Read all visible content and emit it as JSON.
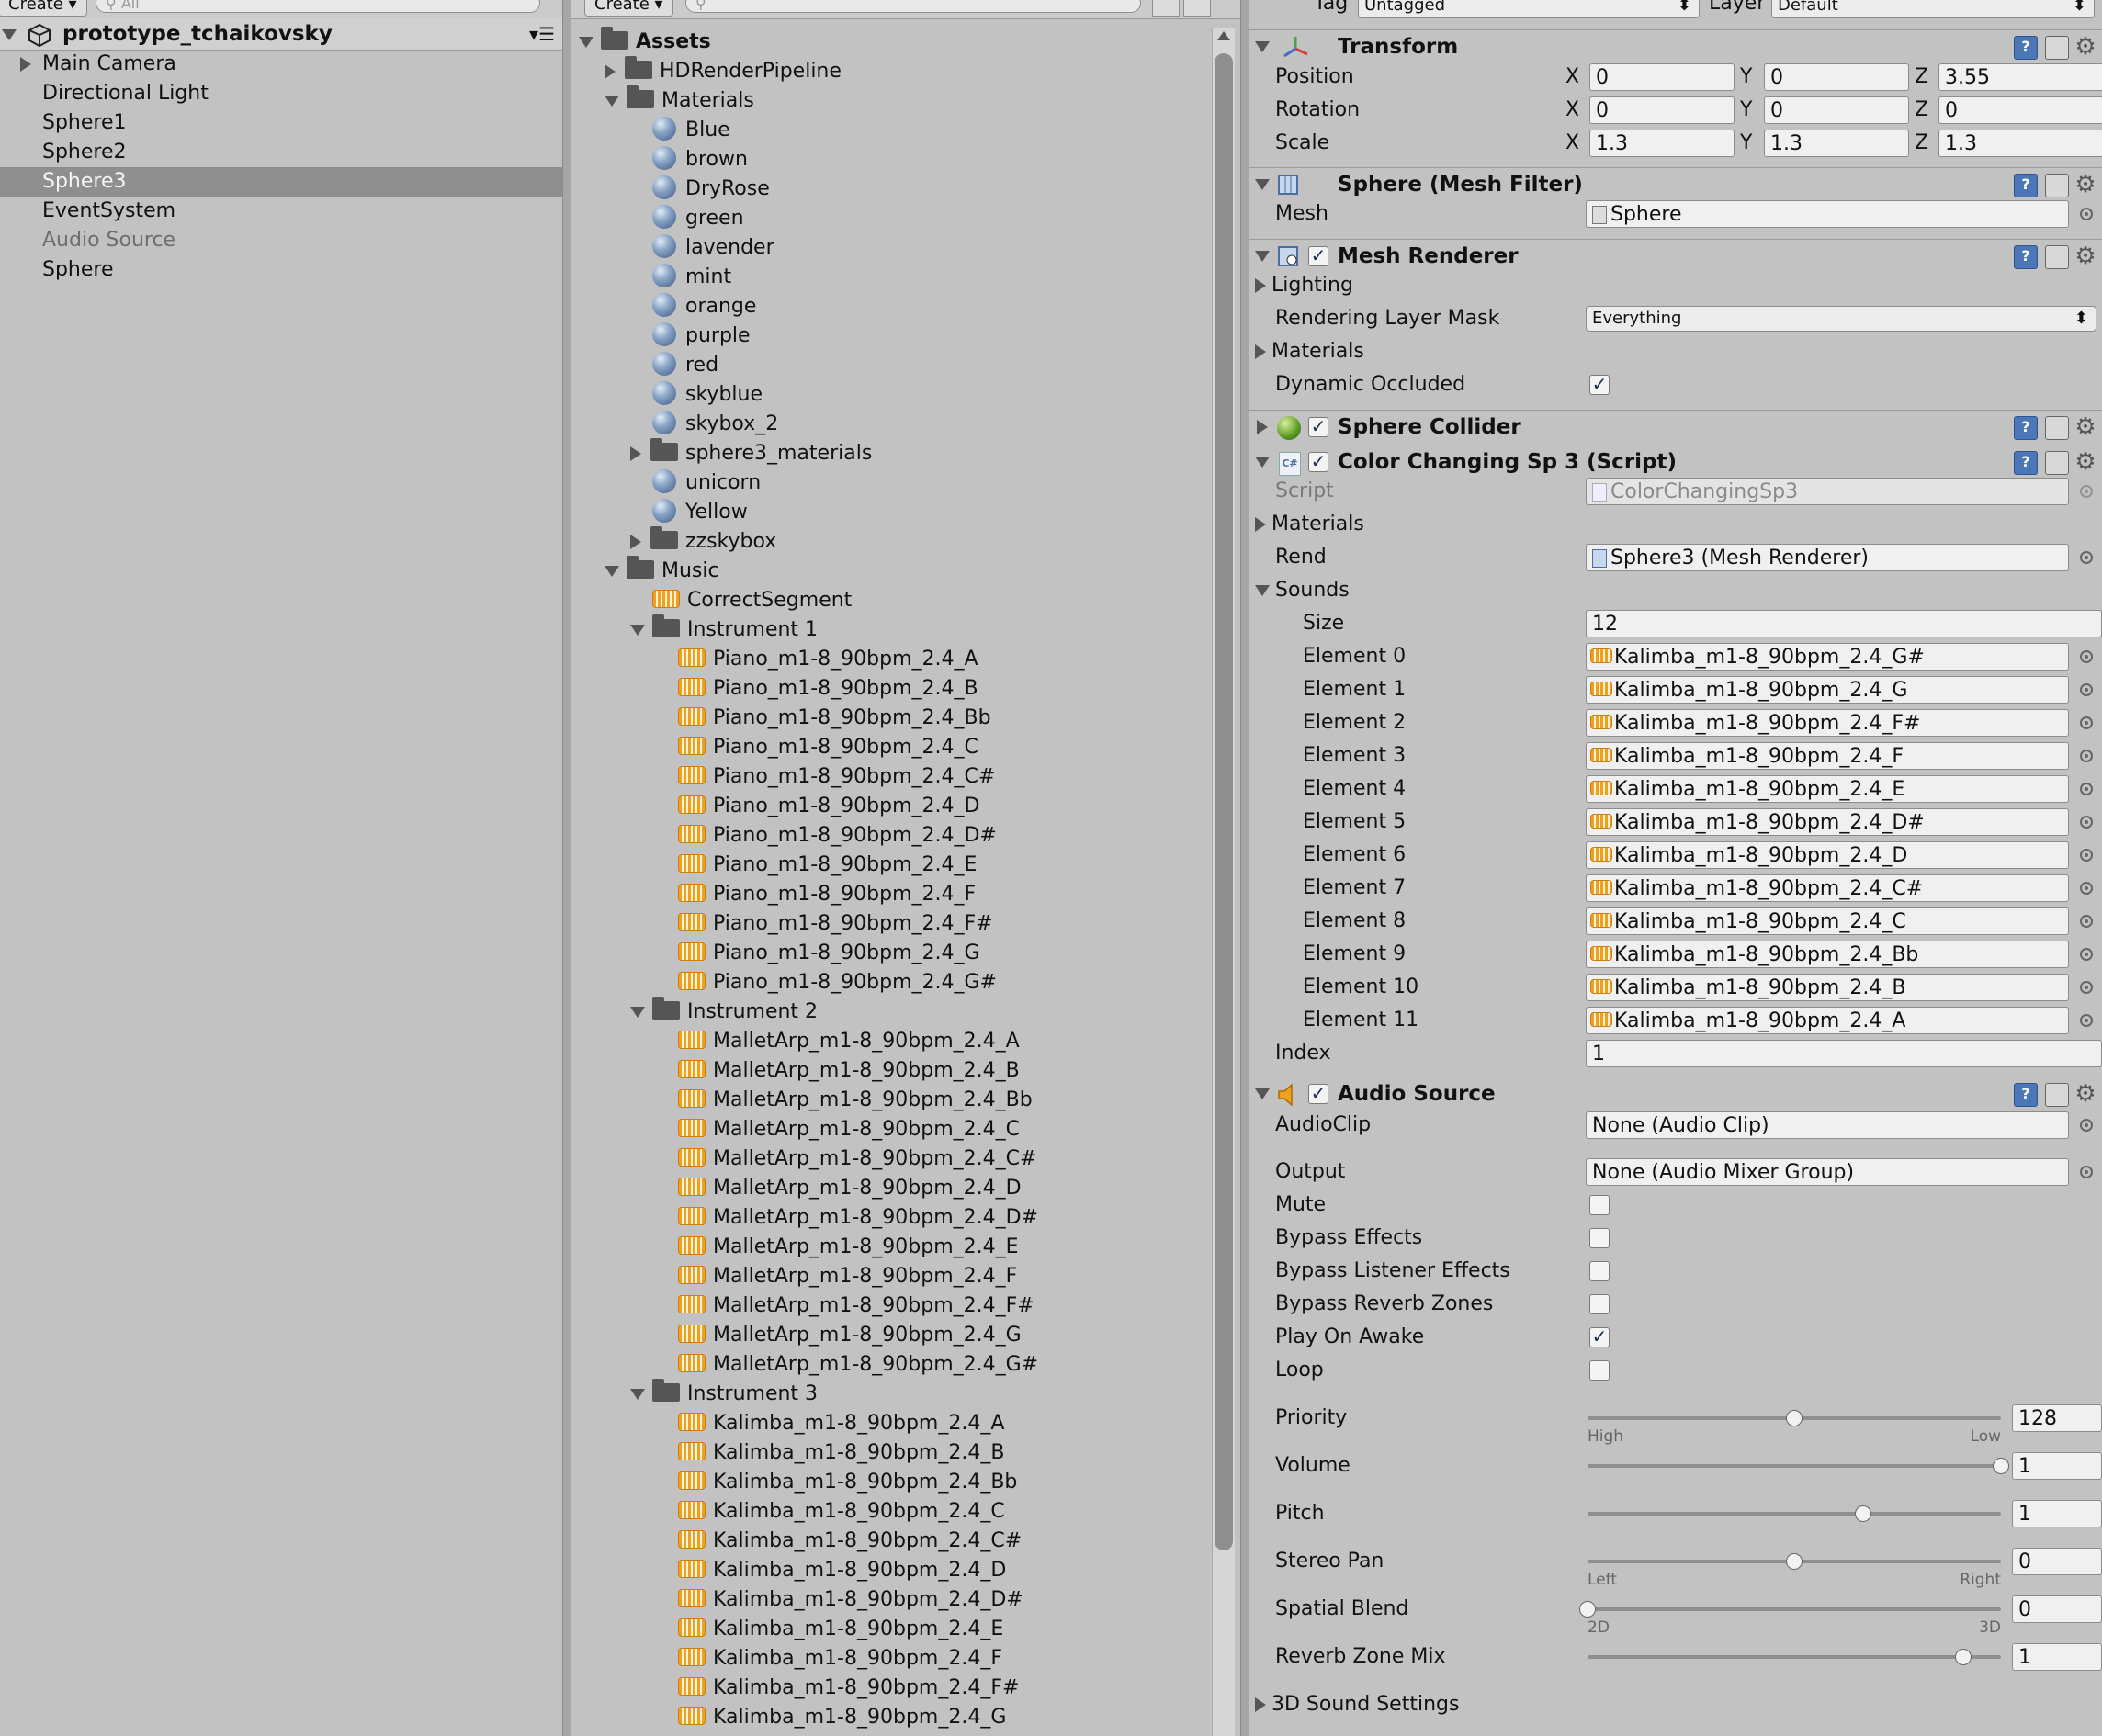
{
  "hierarchy": {
    "create_label": "Create",
    "search_placeholder": "All",
    "scene_name": "prototype_tchaikovsky",
    "items": [
      {
        "label": "Main Camera",
        "expandable": true
      },
      {
        "label": "Directional Light"
      },
      {
        "label": "Sphere1"
      },
      {
        "label": "Sphere2"
      },
      {
        "label": "Sphere3",
        "selected": true
      },
      {
        "label": "EventSystem"
      },
      {
        "label": "Audio Source",
        "inactive": true
      },
      {
        "label": "Sphere"
      }
    ]
  },
  "project": {
    "create_label": "Create",
    "root": "Assets",
    "rows": [
      {
        "label": "HDRenderPipeline",
        "kind": "folder",
        "depth": 1,
        "arrow": "collapsed"
      },
      {
        "label": "Materials",
        "kind": "folder",
        "depth": 1,
        "arrow": "expanded"
      },
      {
        "label": "Blue",
        "kind": "material",
        "depth": 2
      },
      {
        "label": "brown",
        "kind": "material",
        "depth": 2
      },
      {
        "label": "DryRose",
        "kind": "material",
        "depth": 2
      },
      {
        "label": "green",
        "kind": "material",
        "depth": 2
      },
      {
        "label": "lavender",
        "kind": "material",
        "depth": 2
      },
      {
        "label": "mint",
        "kind": "material",
        "depth": 2
      },
      {
        "label": "orange",
        "kind": "material",
        "depth": 2
      },
      {
        "label": "purple",
        "kind": "material",
        "depth": 2
      },
      {
        "label": "red",
        "kind": "material",
        "depth": 2
      },
      {
        "label": "skyblue",
        "kind": "material",
        "depth": 2
      },
      {
        "label": "skybox_2",
        "kind": "material",
        "depth": 2
      },
      {
        "label": "sphere3_materials",
        "kind": "folder",
        "depth": 2,
        "arrow": "collapsed"
      },
      {
        "label": "unicorn",
        "kind": "material",
        "depth": 2
      },
      {
        "label": "Yellow",
        "kind": "material",
        "depth": 2
      },
      {
        "label": "zzskybox",
        "kind": "folder",
        "depth": 2,
        "arrow": "collapsed"
      },
      {
        "label": "Music",
        "kind": "folder",
        "depth": 1,
        "arrow": "expanded"
      },
      {
        "label": "CorrectSegment",
        "kind": "audio",
        "depth": 2
      },
      {
        "label": "Instrument 1",
        "kind": "folder",
        "depth": 2,
        "arrow": "expanded"
      },
      {
        "label": "Piano_m1-8_90bpm_2.4_A",
        "kind": "audio",
        "depth": 3
      },
      {
        "label": "Piano_m1-8_90bpm_2.4_B",
        "kind": "audio",
        "depth": 3
      },
      {
        "label": "Piano_m1-8_90bpm_2.4_Bb",
        "kind": "audio",
        "depth": 3
      },
      {
        "label": "Piano_m1-8_90bpm_2.4_C",
        "kind": "audio",
        "depth": 3
      },
      {
        "label": "Piano_m1-8_90bpm_2.4_C#",
        "kind": "audio",
        "depth": 3
      },
      {
        "label": "Piano_m1-8_90bpm_2.4_D",
        "kind": "audio",
        "depth": 3
      },
      {
        "label": "Piano_m1-8_90bpm_2.4_D#",
        "kind": "audio",
        "depth": 3
      },
      {
        "label": "Piano_m1-8_90bpm_2.4_E",
        "kind": "audio",
        "depth": 3
      },
      {
        "label": "Piano_m1-8_90bpm_2.4_F",
        "kind": "audio",
        "depth": 3
      },
      {
        "label": "Piano_m1-8_90bpm_2.4_F#",
        "kind": "audio",
        "depth": 3
      },
      {
        "label": "Piano_m1-8_90bpm_2.4_G",
        "kind": "audio",
        "depth": 3
      },
      {
        "label": "Piano_m1-8_90bpm_2.4_G#",
        "kind": "audio",
        "depth": 3
      },
      {
        "label": "Instrument 2",
        "kind": "folder",
        "depth": 2,
        "arrow": "expanded"
      },
      {
        "label": "MalletArp_m1-8_90bpm_2.4_A",
        "kind": "audio",
        "depth": 3
      },
      {
        "label": "MalletArp_m1-8_90bpm_2.4_B",
        "kind": "audio",
        "depth": 3
      },
      {
        "label": "MalletArp_m1-8_90bpm_2.4_Bb",
        "kind": "audio",
        "depth": 3
      },
      {
        "label": "MalletArp_m1-8_90bpm_2.4_C",
        "kind": "audio",
        "depth": 3
      },
      {
        "label": "MalletArp_m1-8_90bpm_2.4_C#",
        "kind": "audio",
        "depth": 3
      },
      {
        "label": "MalletArp_m1-8_90bpm_2.4_D",
        "kind": "audio",
        "depth": 3
      },
      {
        "label": "MalletArp_m1-8_90bpm_2.4_D#",
        "kind": "audio",
        "depth": 3
      },
      {
        "label": "MalletArp_m1-8_90bpm_2.4_E",
        "kind": "audio",
        "depth": 3
      },
      {
        "label": "MalletArp_m1-8_90bpm_2.4_F",
        "kind": "audio",
        "depth": 3
      },
      {
        "label": "MalletArp_m1-8_90bpm_2.4_F#",
        "kind": "audio",
        "depth": 3
      },
      {
        "label": "MalletArp_m1-8_90bpm_2.4_G",
        "kind": "audio",
        "depth": 3
      },
      {
        "label": "MalletArp_m1-8_90bpm_2.4_G#",
        "kind": "audio",
        "depth": 3
      },
      {
        "label": "Instrument 3",
        "kind": "folder",
        "depth": 2,
        "arrow": "expanded"
      },
      {
        "label": "Kalimba_m1-8_90bpm_2.4_A",
        "kind": "audio",
        "depth": 3
      },
      {
        "label": "Kalimba_m1-8_90bpm_2.4_B",
        "kind": "audio",
        "depth": 3
      },
      {
        "label": "Kalimba_m1-8_90bpm_2.4_Bb",
        "kind": "audio",
        "depth": 3
      },
      {
        "label": "Kalimba_m1-8_90bpm_2.4_C",
        "kind": "audio",
        "depth": 3
      },
      {
        "label": "Kalimba_m1-8_90bpm_2.4_C#",
        "kind": "audio",
        "depth": 3
      },
      {
        "label": "Kalimba_m1-8_90bpm_2.4_D",
        "kind": "audio",
        "depth": 3
      },
      {
        "label": "Kalimba_m1-8_90bpm_2.4_D#",
        "kind": "audio",
        "depth": 3
      },
      {
        "label": "Kalimba_m1-8_90bpm_2.4_E",
        "kind": "audio",
        "depth": 3
      },
      {
        "label": "Kalimba_m1-8_90bpm_2.4_F",
        "kind": "audio",
        "depth": 3
      },
      {
        "label": "Kalimba_m1-8_90bpm_2.4_F#",
        "kind": "audio",
        "depth": 3
      },
      {
        "label": "Kalimba_m1-8_90bpm_2.4_G",
        "kind": "audio",
        "depth": 3
      }
    ]
  },
  "inspector": {
    "tag_label": "Tag",
    "tag_value": "Untagged",
    "layer_label": "Layer",
    "layer_value": "Default",
    "transform": {
      "title": "Transform",
      "rows": [
        {
          "label": "Position",
          "x": "0",
          "y": "0",
          "z": "3.55"
        },
        {
          "label": "Rotation",
          "x": "0",
          "y": "0",
          "z": "0"
        },
        {
          "label": "Scale",
          "x": "1.3",
          "y": "1.3",
          "z": "1.3"
        }
      ],
      "axis_x": "X",
      "axis_y": "Y",
      "axis_z": "Z"
    },
    "mesh_filter": {
      "title": "Sphere (Mesh Filter)",
      "mesh_label": "Mesh",
      "mesh_value": "Sphere"
    },
    "mesh_renderer": {
      "title": "Mesh Renderer",
      "lighting": "Lighting",
      "layer_mask_label": "Rendering Layer Mask",
      "layer_mask_value": "Everything",
      "materials": "Materials",
      "dynamic_occluded": "Dynamic Occluded"
    },
    "sphere_collider": {
      "title": "Sphere Collider"
    },
    "script_comp": {
      "title": "Color Changing Sp 3 (Script)",
      "script_label": "Script",
      "script_value": "ColorChangingSp3",
      "materials": "Materials",
      "rend_label": "Rend",
      "rend_value": "Sphere3 (Mesh Renderer)",
      "sounds": "Sounds",
      "size_label": "Size",
      "size_value": "12",
      "elements": [
        {
          "label": "Element 0",
          "value": "Kalimba_m1-8_90bpm_2.4_G#"
        },
        {
          "label": "Element 1",
          "value": "Kalimba_m1-8_90bpm_2.4_G"
        },
        {
          "label": "Element 2",
          "value": "Kalimba_m1-8_90bpm_2.4_F#"
        },
        {
          "label": "Element 3",
          "value": "Kalimba_m1-8_90bpm_2.4_F"
        },
        {
          "label": "Element 4",
          "value": "Kalimba_m1-8_90bpm_2.4_E"
        },
        {
          "label": "Element 5",
          "value": "Kalimba_m1-8_90bpm_2.4_D#"
        },
        {
          "label": "Element 6",
          "value": "Kalimba_m1-8_90bpm_2.4_D"
        },
        {
          "label": "Element 7",
          "value": "Kalimba_m1-8_90bpm_2.4_C#"
        },
        {
          "label": "Element 8",
          "value": "Kalimba_m1-8_90bpm_2.4_C"
        },
        {
          "label": "Element 9",
          "value": "Kalimba_m1-8_90bpm_2.4_Bb"
        },
        {
          "label": "Element 10",
          "value": "Kalimba_m1-8_90bpm_2.4_B"
        },
        {
          "label": "Element 11",
          "value": "Kalimba_m1-8_90bpm_2.4_A"
        }
      ],
      "index_label": "Index",
      "index_value": "1"
    },
    "audio_source": {
      "title": "Audio Source",
      "clip_label": "AudioClip",
      "clip_value": "None (Audio Clip)",
      "output_label": "Output",
      "output_value": "None (Audio Mixer Group)",
      "toggles": [
        {
          "label": "Mute",
          "checked": false
        },
        {
          "label": "Bypass Effects",
          "checked": false
        },
        {
          "label": "Bypass Listener Effects",
          "checked": false
        },
        {
          "label": "Bypass Reverb Zones",
          "checked": false
        },
        {
          "label": "Play On Awake",
          "checked": true
        },
        {
          "label": "Loop",
          "checked": false
        }
      ],
      "sliders": [
        {
          "label": "Priority",
          "value": "128",
          "fraction": 0.5,
          "min_label": "High",
          "max_label": "Low"
        },
        {
          "label": "Volume",
          "value": "1",
          "fraction": 1.0,
          "min_label": "",
          "max_label": ""
        },
        {
          "label": "Pitch",
          "value": "1",
          "fraction": 0.667,
          "min_label": "",
          "max_label": ""
        },
        {
          "label": "Stereo Pan",
          "value": "0",
          "fraction": 0.5,
          "min_label": "Left",
          "max_label": "Right"
        },
        {
          "label": "Spatial Blend",
          "value": "0",
          "fraction": 0.0,
          "min_label": "2D",
          "max_label": "3D"
        },
        {
          "label": "Reverb Zone Mix",
          "value": "1",
          "fraction": 0.909,
          "min_label": "",
          "max_label": ""
        }
      ],
      "sound_settings": "3D Sound Settings"
    }
  }
}
